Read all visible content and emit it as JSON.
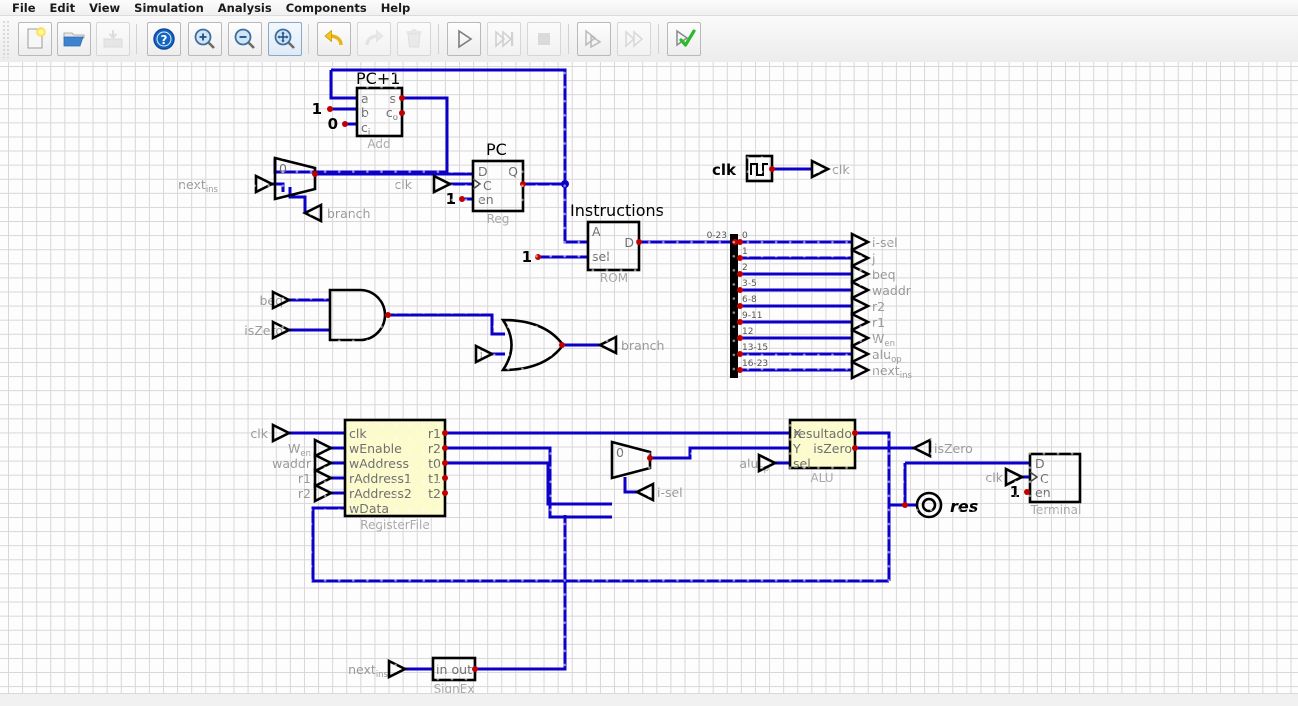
{
  "window": {
    "menu": [
      "File",
      "Edit",
      "View",
      "Simulation",
      "Analysis",
      "Components",
      "Help"
    ]
  },
  "toolbar": {
    "buttons": [
      {
        "name": "new-file-button",
        "icon": "new-file-icon",
        "enabled": true
      },
      {
        "name": "open-file-button",
        "icon": "open-folder-icon",
        "enabled": true
      },
      {
        "name": "save-file-button",
        "icon": "save-icon",
        "enabled": false
      },
      {
        "name": "help-button",
        "icon": "help-circle-icon",
        "enabled": true
      },
      {
        "name": "zoom-in-button",
        "icon": "zoom-in-icon",
        "enabled": true
      },
      {
        "name": "zoom-out-button",
        "icon": "zoom-out-icon",
        "enabled": true
      },
      {
        "name": "zoom-fit-button",
        "icon": "zoom-fit-icon",
        "enabled": true,
        "selected": true
      },
      {
        "name": "undo-button",
        "icon": "undo-arrow-icon",
        "enabled": true
      },
      {
        "name": "redo-button",
        "icon": "redo-arrow-icon",
        "enabled": false
      },
      {
        "name": "delete-button",
        "icon": "trash-icon",
        "enabled": false
      },
      {
        "name": "run-simulation-button",
        "icon": "play-icon",
        "enabled": true
      },
      {
        "name": "step-simulation-button",
        "icon": "step-forward-icon",
        "enabled": false
      },
      {
        "name": "stop-simulation-button",
        "icon": "stop-square-icon",
        "enabled": false
      },
      {
        "name": "microstep-button",
        "icon": "micro-step-icon",
        "enabled": true
      },
      {
        "name": "fast-forward-button",
        "icon": "fast-forward-icon",
        "enabled": false
      },
      {
        "name": "check-circuit-button",
        "icon": "check-mark-icon",
        "enabled": true
      }
    ]
  },
  "circuit": {
    "labels": {
      "pc_plus_1": "PC+1",
      "pc": "PC",
      "instructions": "Instructions",
      "clk_source": "clk",
      "res_probe": "res"
    },
    "components": {
      "adder": {
        "name": "Add",
        "pins_in": [
          "a",
          "b",
          "c"
        ],
        "pin_ci_sub": "i",
        "pins_out": [
          "s",
          "c"
        ],
        "pin_co_sub": "o"
      },
      "pc_register": {
        "name": "Reg",
        "pins": [
          "D",
          "C",
          "en",
          "Q"
        ]
      },
      "rom": {
        "name": "ROM",
        "pins": [
          "A",
          "sel",
          "D"
        ]
      },
      "register_file": {
        "name": "RegisterFile",
        "inputs": [
          "clk",
          "wEnable",
          "wAddress",
          "rAddress1",
          "rAddress2",
          "wData"
        ],
        "outputs": [
          "r1",
          "r2",
          "t0",
          "t1",
          "t2"
        ]
      },
      "alu": {
        "name": "ALU",
        "inputs": [
          "X",
          "Y",
          "sel"
        ],
        "outputs": [
          "resultado",
          "isZero"
        ]
      },
      "terminal": {
        "name": "Terminal",
        "pins": [
          "D",
          "C",
          "en"
        ]
      },
      "signex": {
        "name": "SignEx",
        "pins": [
          "in",
          "out"
        ]
      },
      "mux_pc": {
        "label": "0"
      },
      "mux_alu": {
        "label": "0"
      }
    },
    "splitter": {
      "bus_label": "0-23",
      "bits": [
        "0",
        "1",
        "2",
        "3-5",
        "6-8",
        "9-11",
        "12",
        "13-15",
        "16-23"
      ],
      "outputs": [
        {
          "base": "i-sel",
          "sub": ""
        },
        {
          "base": "j",
          "sub": ""
        },
        {
          "base": "beq",
          "sub": ""
        },
        {
          "base": "waddr",
          "sub": ""
        },
        {
          "base": "r2",
          "sub": ""
        },
        {
          "base": "r1",
          "sub": ""
        },
        {
          "base": "W",
          "sub": "en"
        },
        {
          "base": "alu",
          "sub": "op"
        },
        {
          "base": "next",
          "sub": "ins"
        }
      ]
    },
    "tunnels": {
      "next_ins_top": {
        "base": "next",
        "sub": "ins"
      },
      "branch_mux": "branch",
      "clk_pc": "clk",
      "clk_out": "clk",
      "beq": "beq",
      "iszero_gate": "isZero",
      "j": "j",
      "branch_out": "branch",
      "clk_rf": "clk",
      "wen": {
        "base": "W",
        "sub": "en"
      },
      "waddr": "waddr",
      "r1": "r1",
      "r2": "r2",
      "aluop": {
        "base": "alu",
        "sub": "op"
      },
      "isel": "i-sel",
      "iszero_out": "isZero",
      "clk_term": "clk",
      "next_ins_bottom": {
        "base": "next",
        "sub": "ins"
      }
    },
    "constants": {
      "adder_b": "1",
      "adder_ci": "0",
      "pc_en": "1",
      "rom_sel": "1",
      "terminal_en": "1"
    },
    "colors": {
      "wire": "#0c00c8",
      "block_fill": "#fbfbcd",
      "connection_dot": "#c00000",
      "pin_label": "#9a9a9a"
    }
  }
}
